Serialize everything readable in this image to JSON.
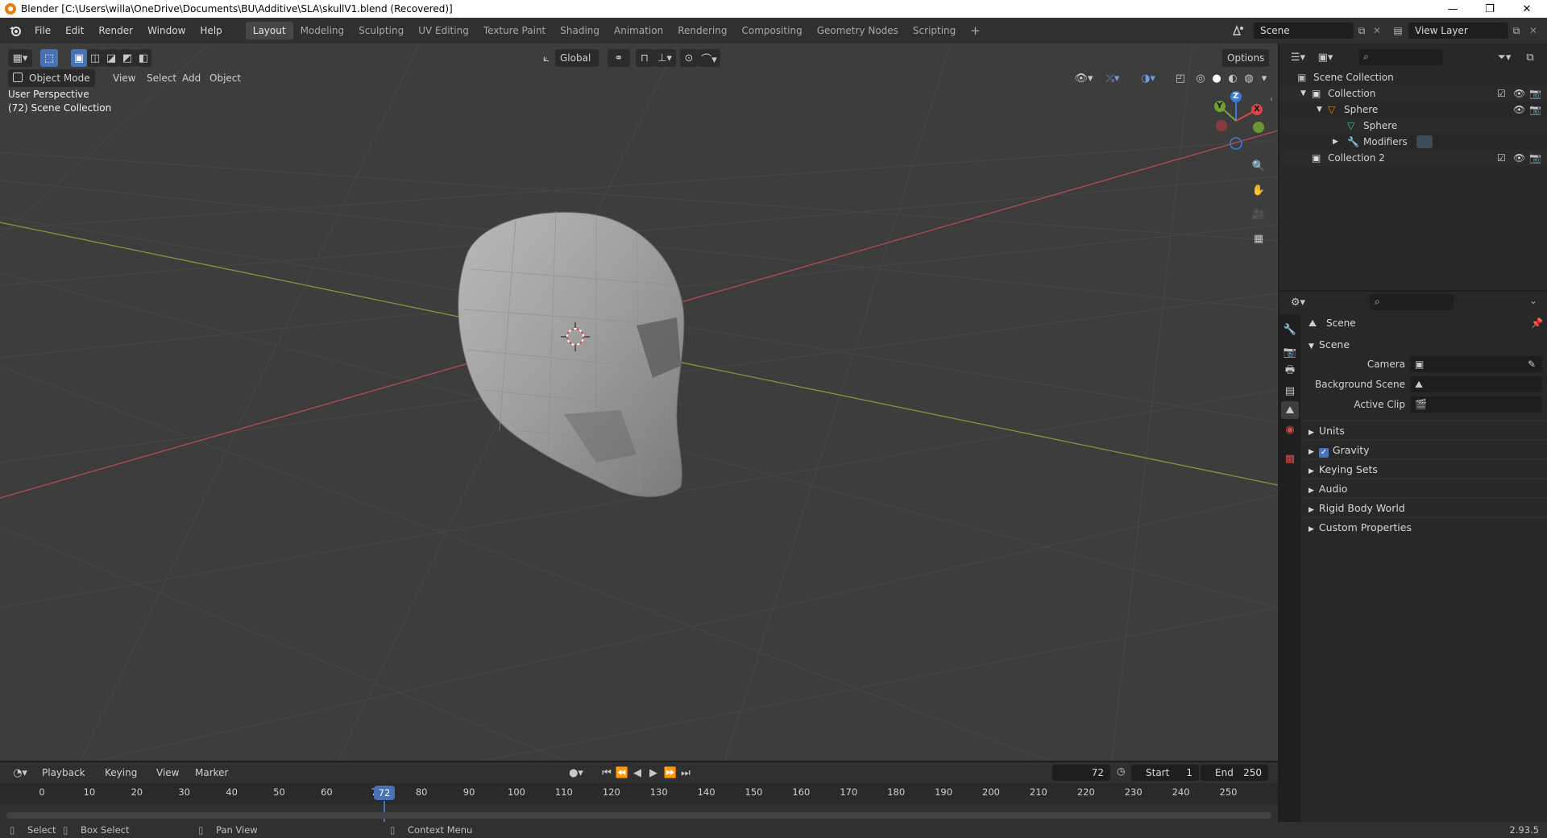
{
  "window": {
    "title": "Blender [C:\\Users\\willa\\OneDrive\\Documents\\BU\\Additive\\SLA\\skullV1.blend (Recovered)]",
    "minimize": "—",
    "restore": "❐",
    "close": "✕"
  },
  "menu": {
    "items": [
      "File",
      "Edit",
      "Render",
      "Window",
      "Help"
    ]
  },
  "workspaces": {
    "tabs": [
      "Layout",
      "Modeling",
      "Sculpting",
      "UV Editing",
      "Texture Paint",
      "Shading",
      "Animation",
      "Rendering",
      "Compositing",
      "Geometry Nodes",
      "Scripting"
    ],
    "active": "Layout",
    "add": "+"
  },
  "scene_selector": {
    "value": "Scene"
  },
  "view_layer_selector": {
    "value": "View Layer"
  },
  "viewport_header": {
    "mode": "Object Mode",
    "menus": [
      "View",
      "Select",
      "Add",
      "Object"
    ],
    "transform_orientation": "Global",
    "options": "Options"
  },
  "viewport": {
    "perspective_label": "User Perspective",
    "collection_label": "(72) Scene Collection",
    "gizmo": {
      "z": "Z",
      "y": "Y",
      "x": "X"
    },
    "colors": {
      "x_axis": "#b34b52",
      "y_axis": "#7a9b3c",
      "bg": "#3d3d3d"
    }
  },
  "outliner": {
    "root": "Scene Collection",
    "items": [
      {
        "label": "Collection"
      },
      {
        "label": "Sphere"
      },
      {
        "label": "Sphere"
      },
      {
        "label": "Modifiers"
      },
      {
        "label": "Collection 2"
      }
    ]
  },
  "properties": {
    "context": "Scene",
    "panel": "Scene",
    "fields": [
      {
        "label": "Camera",
        "value": ""
      },
      {
        "label": "Background Scene",
        "value": ""
      },
      {
        "label": "Active Clip",
        "value": ""
      }
    ],
    "subpanels": [
      "Units",
      "Gravity",
      "Keying Sets",
      "Audio",
      "Rigid Body World",
      "Custom Properties"
    ],
    "gravity_checked": true
  },
  "timeline": {
    "menus": [
      "Playback",
      "Keying",
      "View",
      "Marker"
    ],
    "current_frame": "72",
    "start_label": "Start",
    "start_value": "1",
    "end_label": "End",
    "end_value": "250",
    "ticks": [
      "0",
      "10",
      "20",
      "30",
      "40",
      "50",
      "60",
      "7",
      "80",
      "90",
      "100",
      "110",
      "120",
      "130",
      "140",
      "150",
      "160",
      "170",
      "180",
      "190",
      "200",
      "210",
      "220",
      "230",
      "240",
      "250"
    ],
    "playhead_label": "72"
  },
  "statusbar": {
    "items": [
      "Select",
      "Box Select",
      "Pan View",
      "Context Menu"
    ],
    "version": "2.93.5"
  }
}
